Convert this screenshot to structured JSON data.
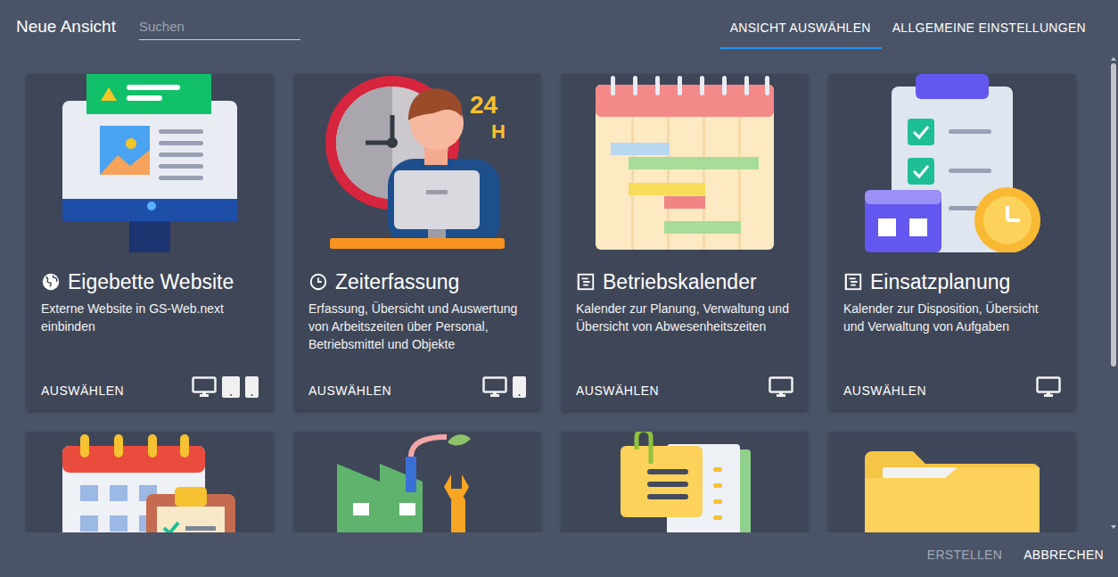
{
  "window": {
    "title": "Neue Ansicht"
  },
  "search": {
    "placeholder": "Suchen",
    "value": ""
  },
  "tabs": [
    {
      "label": "ANSICHT AUSWÄHLEN",
      "selected": true
    },
    {
      "label": "ALLGEMEINE EINSTELLUNGEN",
      "selected": false
    }
  ],
  "cards": [
    {
      "kind": "website",
      "icon": "globe",
      "title": "Eigebette Website",
      "description": "Externe Website in GS-Web.next einbinden",
      "action": "AUSWÄHLEN",
      "desktop": true,
      "tablet": true,
      "phone": true
    },
    {
      "kind": "time",
      "icon": "clock",
      "title": "Zeiterfassung",
      "description": "Erfassung, Übersicht und Auswertung von Arbeitszeiten über Personal, Betriebsmittel und Objekte",
      "action": "AUSWÄHLEN",
      "desktop": true,
      "tablet": false,
      "phone": true,
      "illustration_text": [
        "24",
        "H"
      ]
    },
    {
      "kind": "gantt",
      "icon": "calendar",
      "title": "Betriebskalender",
      "description": "Kalender zur Planung, Verwaltung und Übersicht von Abwesenheitszeiten",
      "action": "AUSWÄHLEN",
      "desktop": true,
      "tablet": false,
      "phone": false
    },
    {
      "kind": "planning",
      "icon": "calendar",
      "title": "Einsatzplanung",
      "description": "Kalender zur Disposition, Übersicht und Verwaltung von Aufgaben",
      "action": "AUSWÄHLEN",
      "desktop": true,
      "tablet": false,
      "phone": false
    }
  ],
  "more_cards": [
    {
      "kind": "calendar-tasks"
    },
    {
      "kind": "factory"
    },
    {
      "kind": "notes"
    },
    {
      "kind": "folder"
    }
  ],
  "scrollbar": {
    "level": 0.66
  },
  "buttons": [
    {
      "label": "ERSTELLEN",
      "disabled": true
    },
    {
      "label": "ABBRECHEN",
      "disabled": false
    }
  ]
}
